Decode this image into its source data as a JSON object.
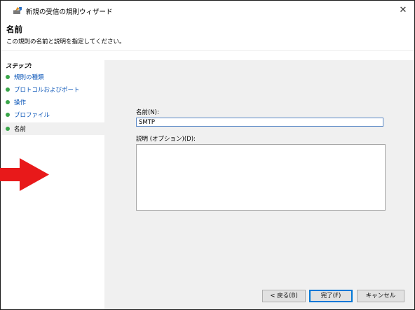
{
  "window": {
    "title": "新規の受信の規則ウィザード",
    "close_glyph": "✕",
    "page_title": "名前",
    "page_subtitle": "この規則の名前と説明を指定してください。"
  },
  "steps": {
    "heading": "ステップ:",
    "items": [
      {
        "label": "規則の種類",
        "state": "done"
      },
      {
        "label": "プロトコルおよびポート",
        "state": "done"
      },
      {
        "label": "操作",
        "state": "done"
      },
      {
        "label": "プロファイル",
        "state": "done"
      },
      {
        "label": "名前",
        "state": "current"
      }
    ]
  },
  "form": {
    "name_label": "名前(N):",
    "name_value": "SMTP",
    "description_label": "説明 (オプション)(D):",
    "description_value": ""
  },
  "buttons": {
    "back": "< 戻る(B)",
    "finish": "完了(F)",
    "cancel": "キャンセル"
  },
  "colors": {
    "step_bullet": "#3aa64a",
    "step_link": "#0a55b8",
    "annotation_arrow": "#e8191a",
    "content_bg": "#f0f0f0"
  },
  "icons": {
    "app": "firewall-shield-icon",
    "annotation": "red-arrow-icon"
  }
}
